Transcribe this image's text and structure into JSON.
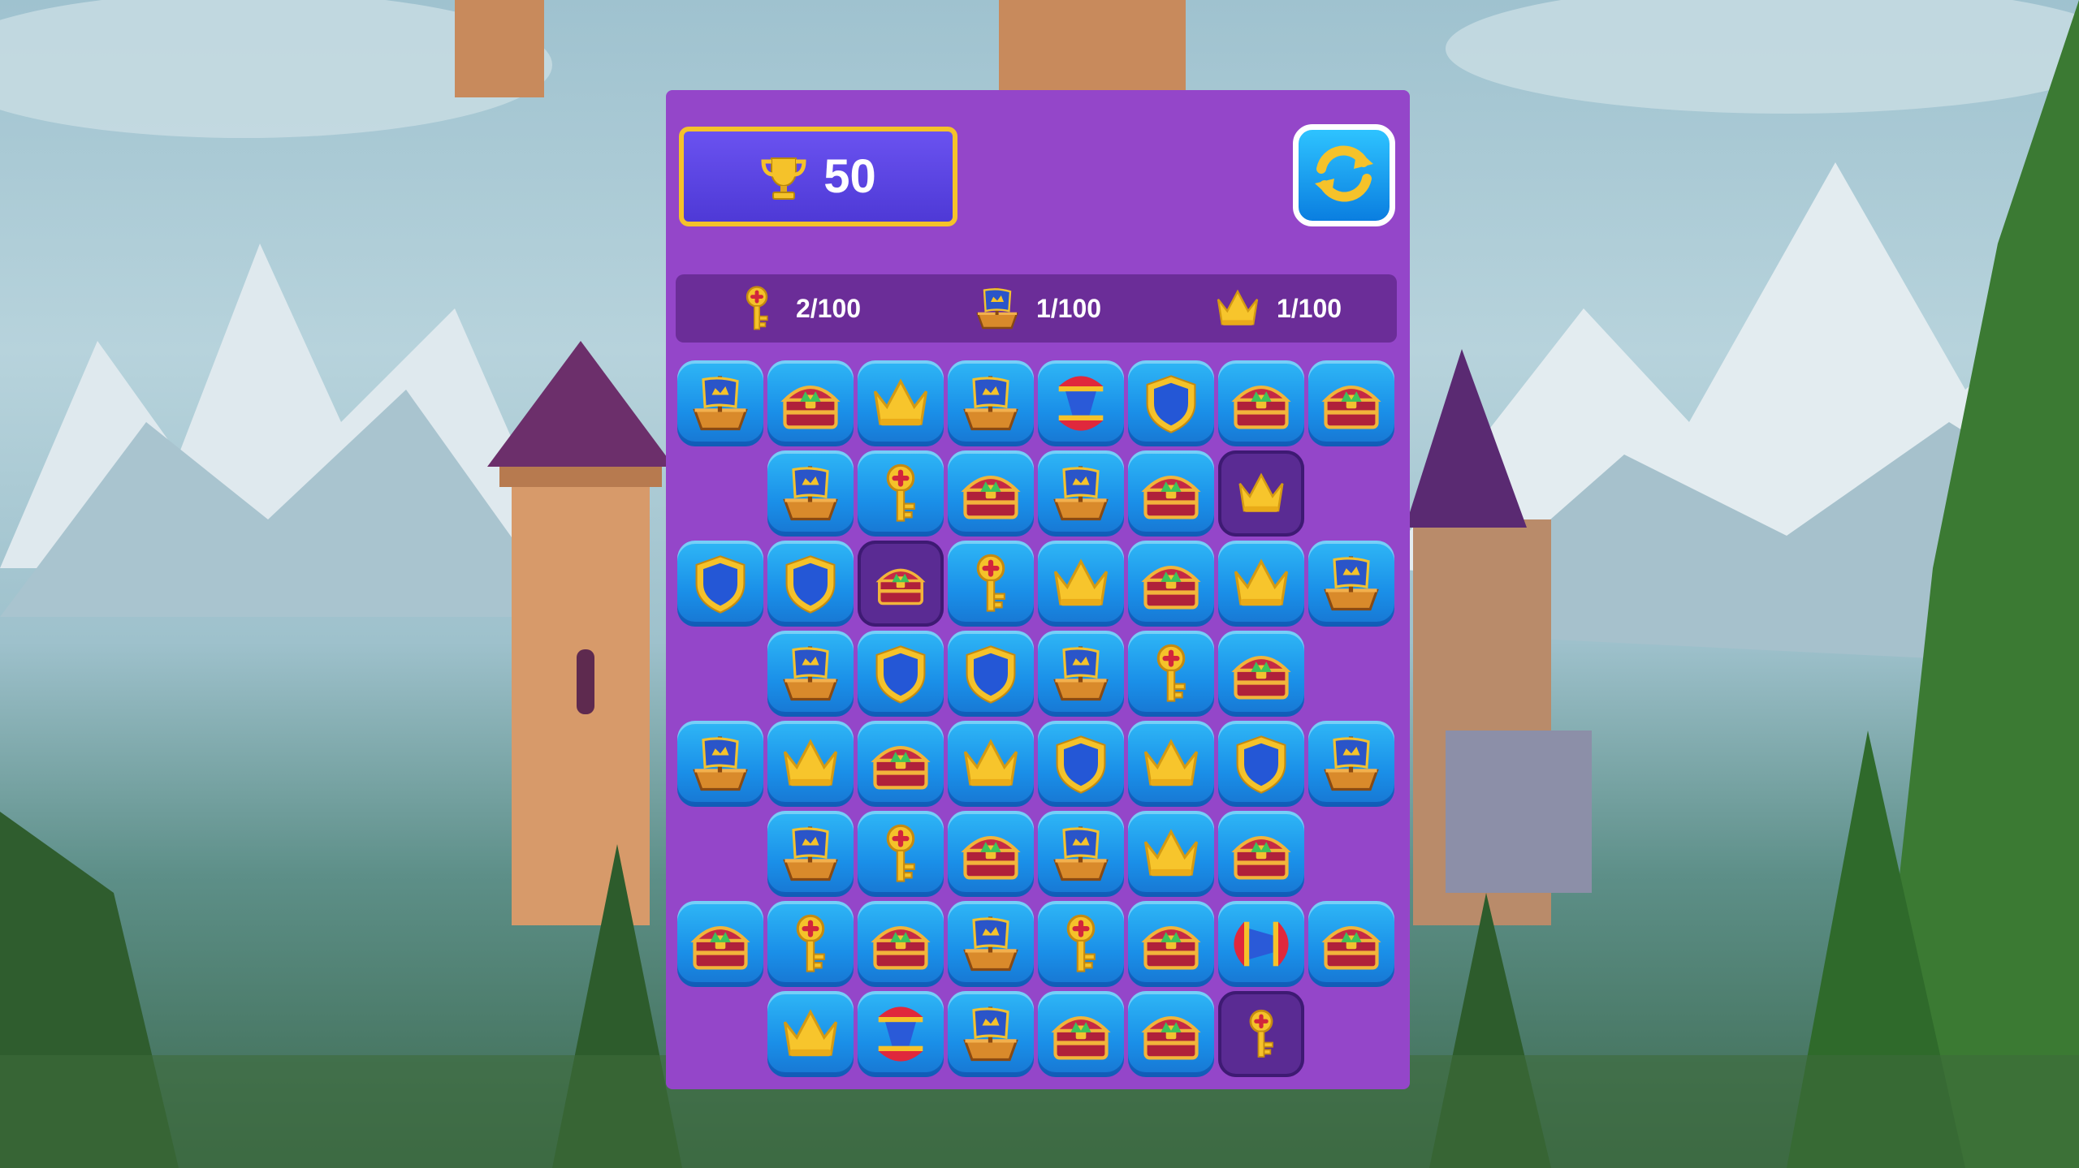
{
  "score": {
    "value": "50",
    "icon": "trophy-icon"
  },
  "refresh_button": {
    "icon": "refresh-icon"
  },
  "goals": [
    {
      "icon": "key-icon",
      "count": "2/100"
    },
    {
      "icon": "ship-icon",
      "count": "1/100"
    },
    {
      "icon": "crown-icon",
      "count": "1/100"
    }
  ],
  "colors": {
    "panel": "#9446c9",
    "goals_bar": "#6b2d98",
    "score_border": "#f5c22a",
    "tile_blue": "#1a8fe8",
    "blocked_tile": "#5a2b93"
  },
  "board": {
    "rows": [
      [
        "ship",
        "chest",
        "crown",
        "ship",
        "lantern-v",
        "shield",
        "chest",
        "chest"
      ],
      [
        null,
        "ship",
        "key",
        "chest",
        "ship",
        "chest",
        "blocked-crown",
        null
      ],
      [
        "shield",
        "shield",
        "blocked-chest",
        "key",
        "crown",
        "chest",
        "crown",
        "ship"
      ],
      [
        null,
        "ship",
        "shield",
        "shield",
        "ship",
        "key",
        "chest",
        null
      ],
      [
        "ship",
        "crown",
        "chest",
        "crown",
        "shield",
        "crown",
        "shield",
        "ship"
      ],
      [
        null,
        "ship",
        "key",
        "chest",
        "ship",
        "crown",
        "chest",
        null
      ],
      [
        "chest",
        "key",
        "chest",
        "ship",
        "key",
        "chest",
        "lantern-h",
        "chest"
      ],
      [
        null,
        "crown",
        "lantern-v",
        "ship",
        "chest",
        "chest",
        "blocked-key",
        null
      ]
    ]
  }
}
